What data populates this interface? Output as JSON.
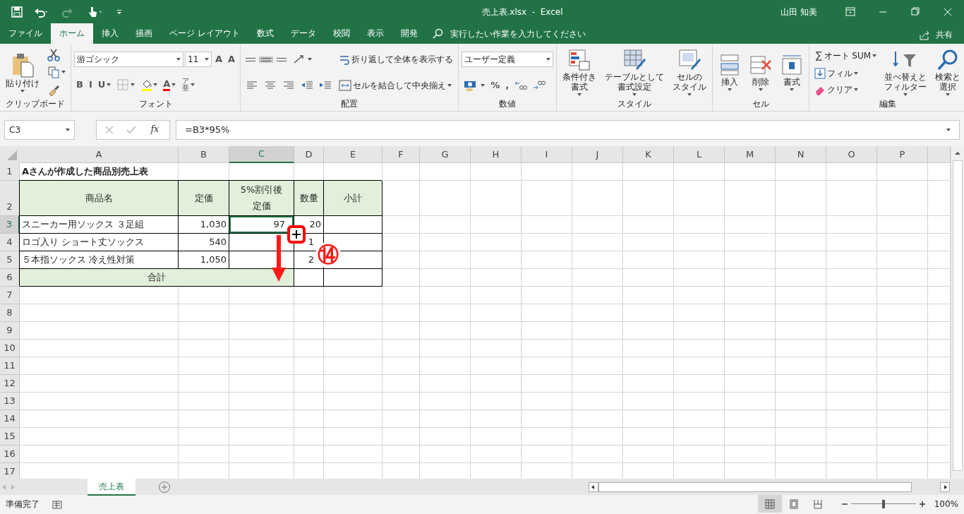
{
  "window": {
    "title": "売上表.xlsx  -  Excel",
    "user": "山田 知美"
  },
  "menu_tabs": [
    {
      "label": "ファイル",
      "selected": false
    },
    {
      "label": "ホーム",
      "selected": true
    },
    {
      "label": "挿入",
      "selected": false
    },
    {
      "label": "描画",
      "selected": false
    },
    {
      "label": "ページ レイアウト",
      "selected": false
    },
    {
      "label": "数式",
      "selected": false
    },
    {
      "label": "データ",
      "selected": false
    },
    {
      "label": "校閲",
      "selected": false
    },
    {
      "label": "表示",
      "selected": false
    },
    {
      "label": "開発",
      "selected": false
    }
  ],
  "tell_me": {
    "placeholder": "実行したい作業を入力してください"
  },
  "share": "共有",
  "ribbon": [
    {
      "label": "クリップボード",
      "columns": [
        [
          [
            {
              "kind": "large",
              "lines": [
                "貼り付け"
              ],
              "caret": true
            }
          ]
        ],
        [
          [
            {
              "kind": "icon",
              "caret": false
            }
          ],
          [
            {
              "kind": "icon",
              "caret": true
            }
          ],
          [
            {
              "kind": "icon",
              "caret": false
            }
          ]
        ]
      ]
    },
    {
      "label": "フォント",
      "columns": [
        [
          [
            {
              "kind": "combo",
              "value": "游ゴシック"
            },
            {
              "kind": "combo",
              "value": "11"
            },
            {
              "kind": "text",
              "text": "A",
              "caret": false
            },
            {
              "kind": "text",
              "text": "A",
              "caret": false
            }
          ],
          [
            {
              "kind": "text",
              "text": "B",
              "caret": false
            },
            {
              "kind": "text",
              "text": "I",
              "caret": false
            },
            {
              "kind": "text",
              "text": "U",
              "caret": true
            },
            {
              "kind": "icon",
              "caret": true
            },
            {
              "kind": "icon",
              "caret": true,
              "color": "#ffff00"
            },
            {
              "kind": "text",
              "text": "A",
              "caret": true,
              "color": "#ff0000"
            },
            {
              "kind": "text",
              "text": "ア亜",
              "caret": true
            }
          ]
        ]
      ]
    },
    {
      "label": "配置",
      "columns": [
        [
          [
            {
              "kind": "icon",
              "caret": false,
              "on": false
            },
            {
              "kind": "icon",
              "caret": false,
              "on": true
            },
            {
              "kind": "icon",
              "caret": false,
              "on": false
            },
            {
              "kind": "icon",
              "caret": true
            }
          ],
          [
            {
              "kind": "icon",
              "caret": false
            },
            {
              "kind": "icon",
              "caret": false
            },
            {
              "kind": "icon",
              "caret": false
            },
            {
              "kind": "icon",
              "caret": false
            },
            {
              "kind": "icon",
              "caret": false
            }
          ]
        ],
        [
          [
            {
              "kind": "small",
              "label": "折り返して全体を表示する",
              "caret": false
            }
          ],
          [
            {
              "kind": "small",
              "label": "セルを結合して中央揃え",
              "caret": true
            }
          ]
        ]
      ]
    },
    {
      "label": "数値",
      "columns": [
        [
          [
            {
              "kind": "combo",
              "value": "ユーザー定義"
            }
          ],
          [
            {
              "kind": "icon",
              "caret": true
            },
            {
              "kind": "text",
              "text": "%",
              "caret": false
            },
            {
              "kind": "text",
              "text": ",",
              "caret": false
            },
            {
              "kind": "icon",
              "caret": false
            },
            {
              "kind": "icon",
              "caret": false
            }
          ]
        ]
      ]
    },
    {
      "label": "スタイル",
      "columns": [
        [
          [
            {
              "kind": "large",
              "lines": [
                "条件付き",
                "書式"
              ],
              "caret": true
            }
          ]
        ],
        [
          [
            {
              "kind": "large",
              "lines": [
                "テーブルとして",
                "書式設定"
              ],
              "caret": true
            }
          ]
        ],
        [
          [
            {
              "kind": "large",
              "lines": [
                "セルの",
                "スタイル"
              ],
              "caret": true
            }
          ]
        ]
      ]
    },
    {
      "label": "セル",
      "columns": [
        [
          [
            {
              "kind": "large",
              "lines": [
                "挿入"
              ],
              "caret": true
            }
          ]
        ],
        [
          [
            {
              "kind": "large",
              "lines": [
                "削除"
              ],
              "caret": true
            }
          ]
        ],
        [
          [
            {
              "kind": "large",
              "lines": [
                "書式"
              ],
              "caret": true
            }
          ]
        ]
      ]
    },
    {
      "label": "編集",
      "columns": [
        [
          [
            {
              "kind": "small",
              "glyph": "Σ",
              "label": "オート SUM",
              "caret": true
            }
          ],
          [
            {
              "kind": "small",
              "label": "フィル",
              "caret": true
            }
          ],
          [
            {
              "kind": "small",
              "label": "クリア",
              "caret": true
            }
          ]
        ],
        [
          [
            {
              "kind": "large",
              "lines": [
                "並べ替えと",
                "フィルター"
              ],
              "caret": true
            }
          ]
        ],
        [
          [
            {
              "kind": "large",
              "lines": [
                "検索と",
                "選択"
              ],
              "caret": true
            }
          ]
        ]
      ]
    }
  ],
  "formula_bar": {
    "name_box": "C3",
    "function_label": "fx",
    "formula": "=B3*95%"
  },
  "columns": [
    {
      "label": "A",
      "selected": false
    },
    {
      "label": "B",
      "selected": false
    },
    {
      "label": "C",
      "selected": true
    },
    {
      "label": "D",
      "selected": false
    },
    {
      "label": "E",
      "selected": false
    },
    {
      "label": "F",
      "selected": false
    },
    {
      "label": "G",
      "selected": false
    },
    {
      "label": "H",
      "selected": false
    },
    {
      "label": "I",
      "selected": false
    },
    {
      "label": "J",
      "selected": false
    },
    {
      "label": "K",
      "selected": false
    },
    {
      "label": "L",
      "selected": false
    },
    {
      "label": "M",
      "selected": false
    },
    {
      "label": "N",
      "selected": false
    },
    {
      "label": "O",
      "selected": false
    },
    {
      "label": "P",
      "selected": false
    }
  ],
  "rows": [
    {
      "label": "1",
      "selected": false,
      "cells": [
        {
          "kind": "title",
          "text": "Aさんが作成した商品別売上表"
        }
      ]
    },
    {
      "label": "2",
      "selected": false,
      "cells": [
        {
          "kind": "header",
          "text": "商品名"
        },
        {
          "kind": "header",
          "text": "定価"
        },
        {
          "kind": "header",
          "lines": [
            "5%割引後",
            "定価"
          ]
        },
        {
          "kind": "header",
          "text": "数量"
        },
        {
          "kind": "header",
          "text": "小計"
        }
      ]
    },
    {
      "label": "3",
      "selected": true,
      "cells": [
        {
          "kind": "text",
          "text": "スニーカー用ソックス ３足組"
        },
        {
          "kind": "number",
          "text": "1,030"
        },
        {
          "kind": "number",
          "text": "97",
          "selected": true
        },
        {
          "kind": "number",
          "text": "20"
        },
        {
          "kind": "empty"
        }
      ]
    },
    {
      "label": "4",
      "selected": false,
      "cells": [
        {
          "kind": "text",
          "text": "ロゴ入り ショート丈ソックス"
        },
        {
          "kind": "number",
          "text": "540"
        },
        {
          "kind": "empty"
        },
        {
          "kind": "number",
          "text": "1"
        },
        {
          "kind": "empty"
        }
      ]
    },
    {
      "label": "5",
      "selected": false,
      "cells": [
        {
          "kind": "text",
          "text": "５本指ソックス 冷え性対策"
        },
        {
          "kind": "number",
          "text": "1,050"
        },
        {
          "kind": "empty"
        },
        {
          "kind": "number",
          "text": "2"
        },
        {
          "kind": "empty"
        }
      ]
    },
    {
      "label": "6",
      "selected": false,
      "cells": [
        {
          "kind": "total",
          "text": "合計"
        },
        {
          "kind": "merged"
        },
        {
          "kind": "merged"
        },
        {
          "kind": "empty"
        },
        {
          "kind": "empty"
        }
      ]
    },
    {
      "label": "7",
      "selected": false
    },
    {
      "label": "8",
      "selected": false
    },
    {
      "label": "9",
      "selected": false
    },
    {
      "label": "10",
      "selected": false
    },
    {
      "label": "11",
      "selected": false
    },
    {
      "label": "12",
      "selected": false
    },
    {
      "label": "13",
      "selected": false
    },
    {
      "label": "14",
      "selected": false
    },
    {
      "label": "15",
      "selected": false
    },
    {
      "label": "16",
      "selected": false
    },
    {
      "label": "17",
      "selected": false
    }
  ],
  "annotations": [
    {
      "kind": "handle-marker"
    },
    {
      "kind": "arrow"
    },
    {
      "kind": "step",
      "text": "⑭"
    }
  ],
  "sheet_tabs": [
    {
      "label": "売上表",
      "selected": true
    }
  ],
  "status_bar": {
    "status": "準備完了",
    "views": [
      {
        "selected": true
      },
      {
        "selected": false
      },
      {
        "selected": false
      }
    ],
    "zoom": {
      "level": 0.5,
      "reading": "100%"
    }
  }
}
